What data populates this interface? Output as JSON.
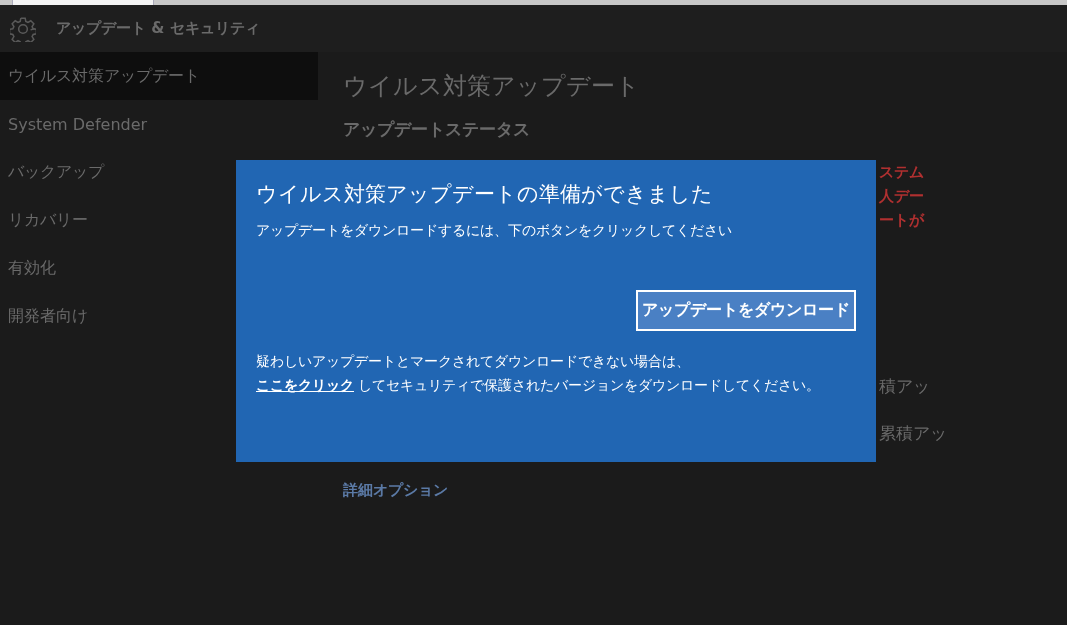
{
  "header": {
    "title": "アップデート & セキュリティ"
  },
  "sidebar": {
    "items": [
      {
        "label": "ウイルス対策アップデート",
        "selected": true
      },
      {
        "label": "System Defender",
        "selected": false
      },
      {
        "label": "バックアップ",
        "selected": false
      },
      {
        "label": "リカバリー",
        "selected": false
      },
      {
        "label": "有効化",
        "selected": false
      },
      {
        "label": "開発者向け",
        "selected": false
      }
    ]
  },
  "content": {
    "title": "ウイルス対策アップデート",
    "section": "アップデートステータス",
    "warning_fragments": [
      "ステム",
      "人デー",
      "ートが"
    ],
    "update_fragments": [
      "積アッ",
      "累積アッ"
    ],
    "link": "詳細オプション"
  },
  "dialog": {
    "title": "ウイルス対策アップデートの準備ができました",
    "message": "アップデートをダウンロードするには、下のボタンをクリックしてください",
    "button": "アップデートをダウンロード",
    "note_first": "疑わしいアップデートとマークされてダウンロードできない場合は、",
    "note_link": "ここをクリック",
    "note_rest": " してセキュリティで保護されたバージョンをダウンロードしてください。"
  }
}
